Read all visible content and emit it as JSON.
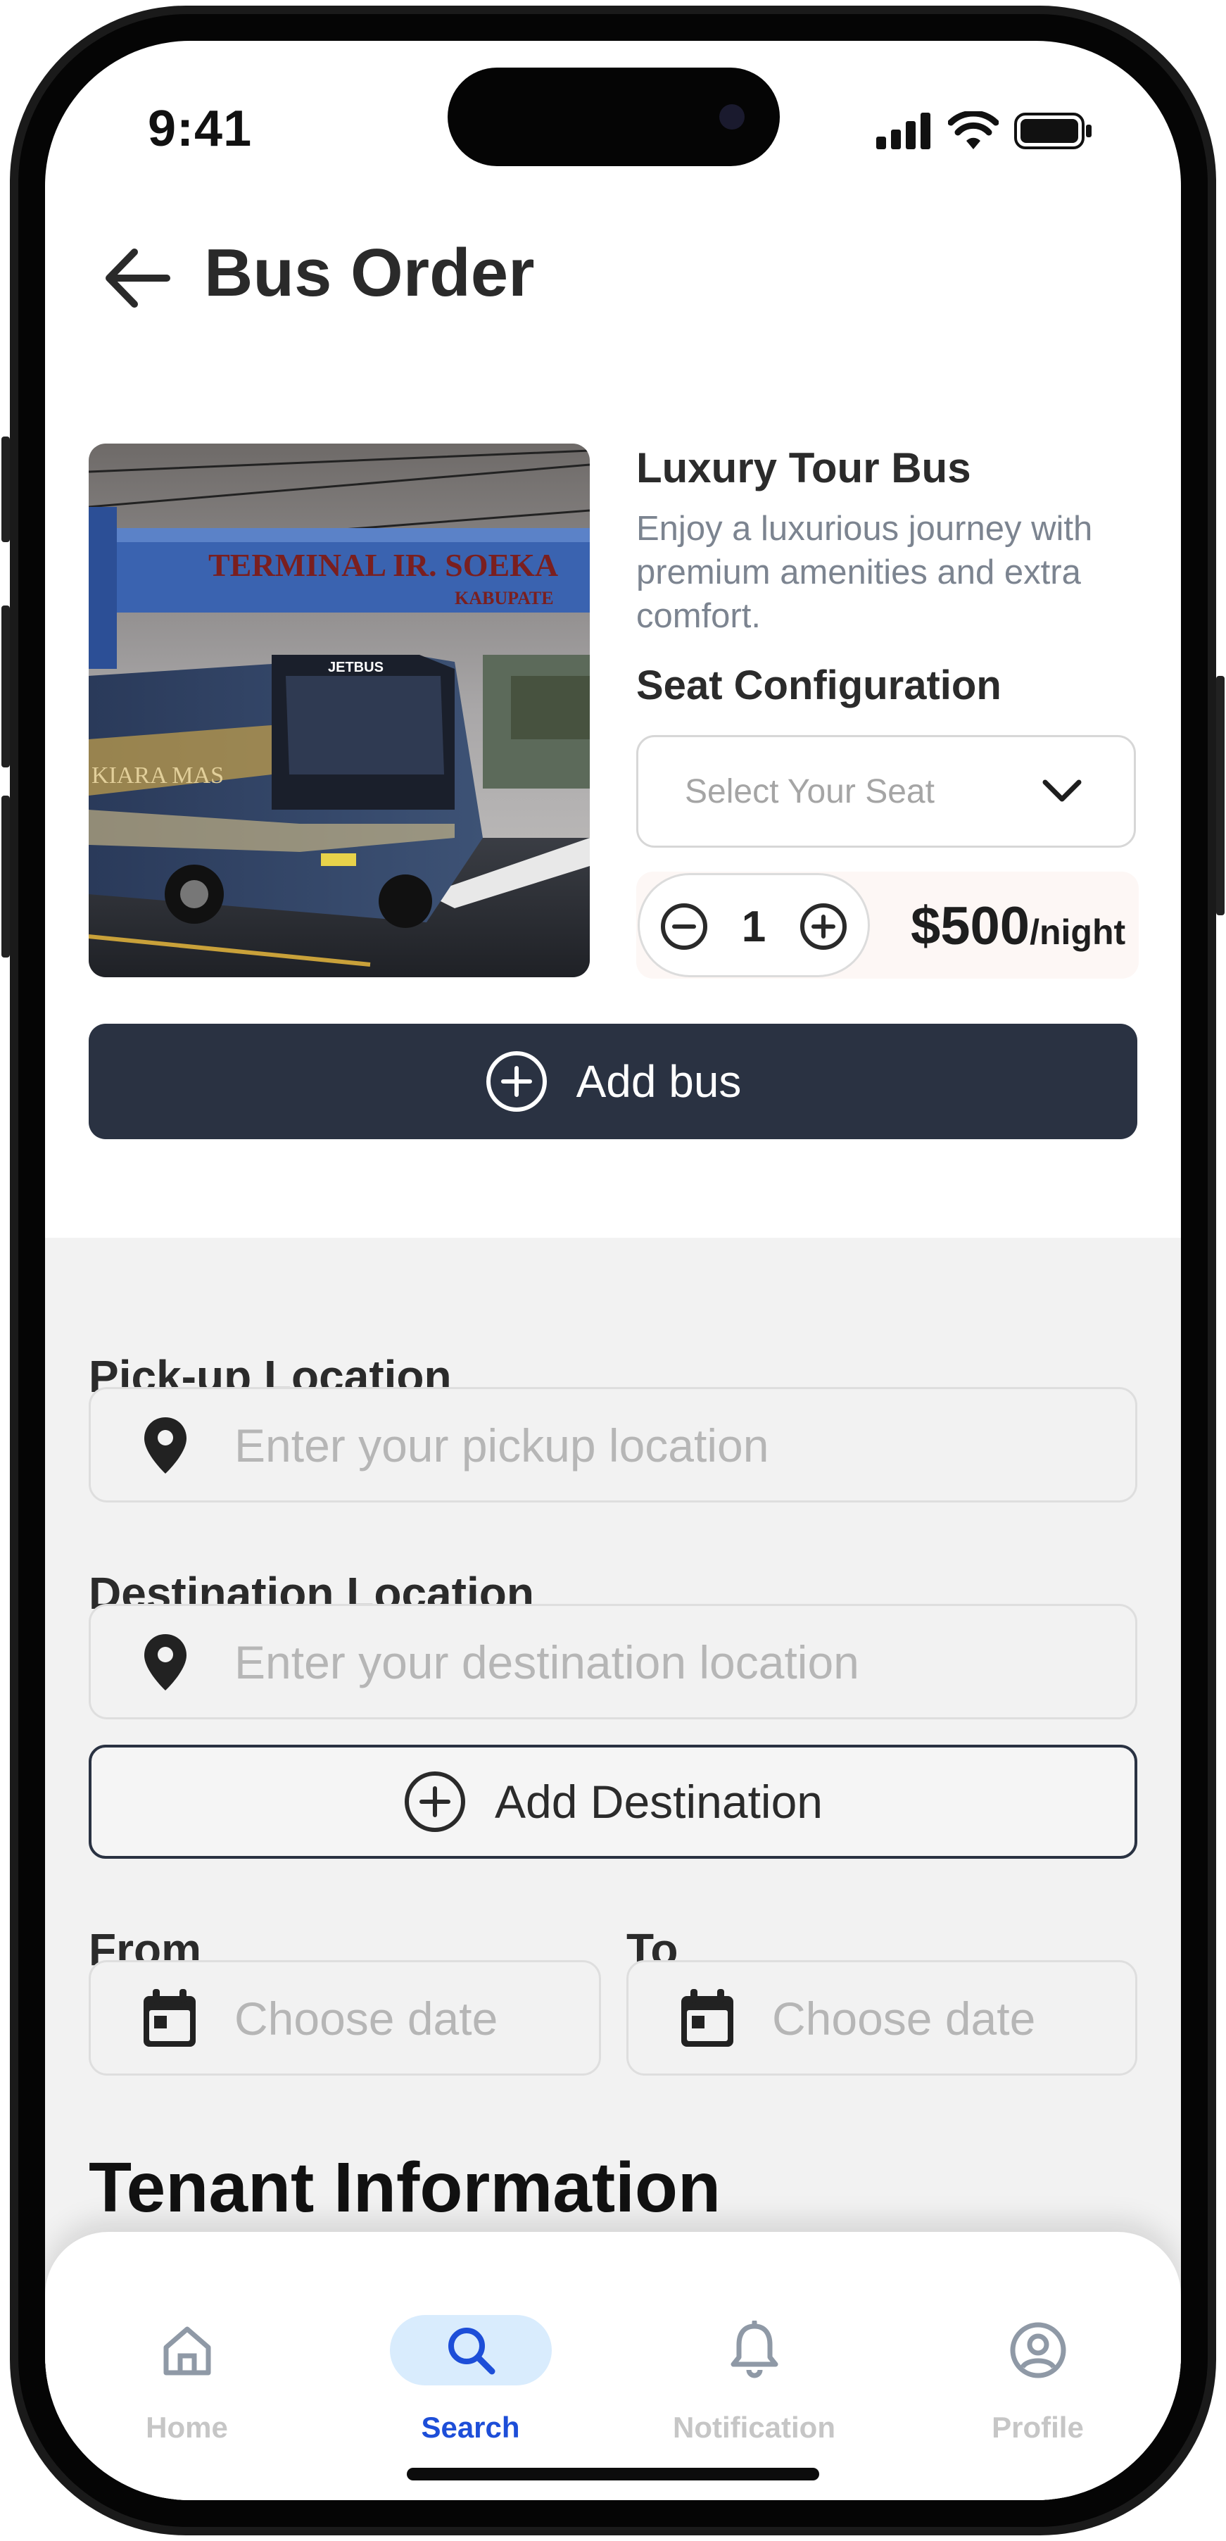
{
  "status_bar": {
    "time": "9:41"
  },
  "header": {
    "title": "Bus Order"
  },
  "product": {
    "name": "Luxury Tour Bus",
    "description": "Enjoy a luxurious journey with premium amenities and extra comfort.",
    "photo_text": {
      "terminal": "TERMINAL IR. SOEKA",
      "district": "KABUPATE",
      "bus_brand": "JETBUS",
      "bus_livery": "KIARA MAS"
    },
    "seat_label": "Seat Configuration",
    "seat_placeholder": "Select Your Seat",
    "quantity": "1",
    "price": "$500",
    "price_unit": "/night",
    "add_button": "Add bus"
  },
  "form": {
    "pickup_label": "Pick-up Location",
    "pickup_placeholder": "Enter your pickup location",
    "destination_label": "Destination Location",
    "destination_placeholder": "Enter your destination location",
    "add_destination": "Add Destination",
    "from_label": "From",
    "from_placeholder": "Choose date",
    "to_label": "To",
    "to_placeholder": "Choose date"
  },
  "section_title": "Tenant Information",
  "nav": {
    "items": [
      {
        "label": "Home",
        "icon": "home-icon"
      },
      {
        "label": "Search",
        "icon": "search-icon",
        "active": true
      },
      {
        "label": "Notification",
        "icon": "bell-icon"
      },
      {
        "label": "Profile",
        "icon": "user-icon"
      }
    ]
  },
  "colors": {
    "primary_dark": "#2a3242",
    "nav_active": "#1d4ed8",
    "nav_active_bg": "#d9ecfd",
    "form_bg": "#f2f2f2"
  }
}
